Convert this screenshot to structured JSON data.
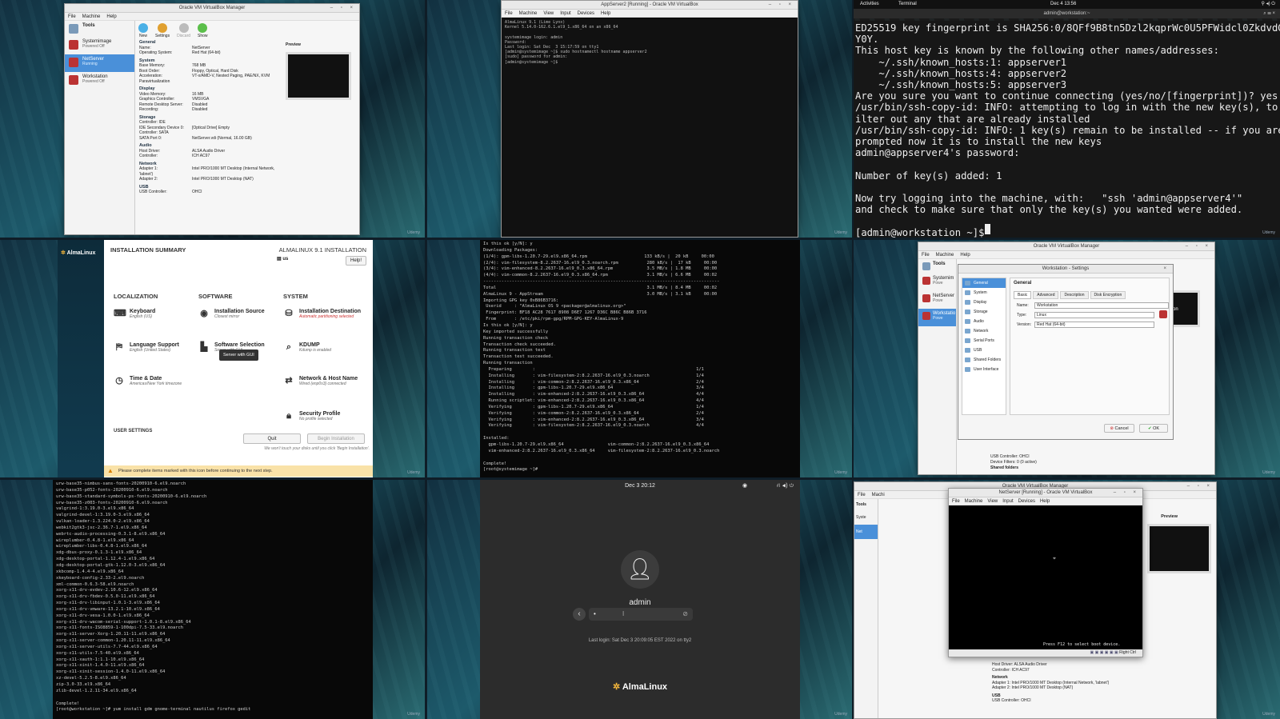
{
  "watermark": "Udemy",
  "p1": {
    "title": "Oracle VM VirtualBox Manager",
    "menu": [
      "File",
      "Machine",
      "Help"
    ],
    "tools_label": "Tools",
    "toolbar": [
      "New",
      "Settings",
      "Discard",
      "Show"
    ],
    "vms": [
      {
        "name": "Systemimage",
        "state": "Powered Off"
      },
      {
        "name": "NetServer",
        "state": "Running"
      },
      {
        "name": "Workstation",
        "state": "Powered Off"
      }
    ],
    "preview_label": "Preview",
    "sections": [
      {
        "title": "General",
        "rows": [
          [
            "Name:",
            "NetServer"
          ],
          [
            "Operating System:",
            "Red Hat (64-bit)"
          ]
        ]
      },
      {
        "title": "System",
        "rows": [
          [
            "Base Memory:",
            "768 MB"
          ],
          [
            "Boot Order:",
            "Floppy, Optical, Hard Disk"
          ],
          [
            "Acceleration:",
            "VT-x/AMD-V, Nested Paging, PAE/NX, KVM Paravirtualization"
          ]
        ]
      },
      {
        "title": "Display",
        "rows": [
          [
            "Video Memory:",
            "16 MB"
          ],
          [
            "Graphics Controller:",
            "VMSVGA"
          ],
          [
            "Remote Desktop Server:",
            "Disabled"
          ],
          [
            "Recording:",
            "Disabled"
          ]
        ]
      },
      {
        "title": "Storage",
        "rows": [
          [
            "Controller: IDE",
            ""
          ],
          [
            "IDE Secondary Device 0:",
            "[Optical Drive] Empty"
          ],
          [
            "Controller: SATA",
            ""
          ],
          [
            "SATA Port 0:",
            "NetServer.vdi (Normal, 16.00 GB)"
          ]
        ]
      },
      {
        "title": "Audio",
        "rows": [
          [
            "Host Driver:",
            "ALSA Audio Driver"
          ],
          [
            "Controller:",
            "ICH AC97"
          ]
        ]
      },
      {
        "title": "Network",
        "rows": [
          [
            "Adapter 1:",
            "Intel PRO/1000 MT Desktop (Internal Network, 'labnet')"
          ],
          [
            "Adapter 2:",
            "Intel PRO/1000 MT Desktop (NAT)"
          ]
        ]
      },
      {
        "title": "USB",
        "rows": [
          [
            "USB Controller:",
            "OHCI"
          ]
        ]
      }
    ]
  },
  "p2": {
    "title": "AppServer2 [Running] - Oracle VM VirtualBox",
    "menu": [
      "File",
      "Machine",
      "View",
      "Input",
      "Devices",
      "Help"
    ],
    "console": "AlmaLinux 9.1 (Lime Lynx)\nKernel 5.14.0-162.6.1.el9_1.x86_64 on an x86_64\n\nsystemimage login: admin\nPassword:\nLast login: Sat Dec  3 15:17:59 on tty1\n[admin@systemimage ~]$ sudo hostnamectl hostname appserver2\n[sudo] password for admin:\n[admin@systemimage ~]$ "
  },
  "p3": {
    "activities": "Activities",
    "app": "Terminal",
    "clock": "Dec 4  13:56",
    "title": "admin@workstation:~",
    "console": "ED25519 key fingerprint is SHA256:0/8QFf9B8tn5Dzl2kqprWc0U5PFWidcl0ZkdvdGJ\nY0Y.\nThis host key is known by the following other names/addresses:\n    ~/.ssh/known_hosts:1: appserver1\n    ~/.ssh/known_hosts:4: appserver2\n    ~/.ssh/known_hosts:5: appserver3\nAre you sure you want to continue connecting (yes/no/[fingerprint])? yes\n/usr/bin/ssh-copy-id: INFO: attempting to log in with the new key(s), to f\nilter out any that are already installed\n/usr/bin/ssh-copy-id: INFO: 1 key(s) remain to be installed -- if you are\nprompted now it is to install the new keys\nadmin@appserver4's password:\n\nNumber of key(s) added: 1\n\nNow try logging into the machine, with:   \"ssh 'admin@appserver4'\"\nand check to make sure that only the key(s) you wanted were added.\n\n[admin@workstation ~]$ "
  },
  "p4": {
    "logo": "AlmaLinux",
    "heading": "INSTALLATION SUMMARY",
    "product": "ALMALINUX 9.1 INSTALLATION",
    "keyboard": "us",
    "help": "Help!",
    "col_localization": "LOCALIZATION",
    "col_software": "SOFTWARE",
    "col_system": "SYSTEM",
    "spokes": {
      "keyboard": {
        "name": "Keyboard",
        "status": "English (US)"
      },
      "language": {
        "name": "Language Support",
        "status": "English (United States)"
      },
      "time": {
        "name": "Time & Date",
        "status": "Americas/New York timezone"
      },
      "source": {
        "name": "Installation Source",
        "status": "Closest mirror"
      },
      "selection": {
        "name": "Software Selection",
        "status": "Server with GUI"
      },
      "destination": {
        "name": "Installation Destination",
        "status": "Automatic partitioning selected"
      },
      "kdump": {
        "name": "KDUMP",
        "status": "Kdump is enabled"
      },
      "network": {
        "name": "Network & Host Name",
        "status": "Wired (enp0s3) connected"
      },
      "security": {
        "name": "Security Profile",
        "status": "No profile selected"
      }
    },
    "tooltip": "Server with GUI",
    "user_settings": "USER SETTINGS",
    "quit": "Quit",
    "begin": "Begin Installation",
    "note": "We won't touch your disks until you click 'Begin Installation'.",
    "warning": "Please complete items marked with this icon before continuing to the next step."
  },
  "p5": {
    "console": "Is this ok [y/N]: y\nDownloading Packages:\n(1/4): gpm-libs-1.20.7-29.el9.x86_64.rpm                      133 kB/s |  20 kB     00:00\n(2/4): vim-filesystem-8.2.2637-16.el9_0.3.noarch.rpm           280 kB/s |  17 kB     00:00\n(3/4): vim-enhanced-8.2.2637-16.el9_0.3.x86_64.rpm             3.5 MB/s | 1.8 MB     00:00\n(4/4): vim-common-8.2.2637-16.el9_0.3.x86_64.rpm               3.1 MB/s | 6.6 MB     00:02\n-------------------------------------------------------------------------------------------\nTotal                                                          3.1 MB/s | 8.4 MB     00:02\nAlmaLinux 9 - AppStream                                        3.0 MB/s | 3.1 kB     00:00\nImporting GPG key 0xB86B3716:\n Userid     : \"AlmaLinux OS 9 <packager@almalinux.org>\"\n Fingerprint: BF18 AC28 7617 8908 D6E7 1267 D36C B86C B86B 3716\n From       : /etc/pki/rpm-gpg/RPM-GPG-KEY-AlmaLinux-9\nIs this ok [y/N]: y\nKey imported successfully\nRunning transaction check\nTransaction check succeeded.\nRunning transaction test\nTransaction test succeeded.\nRunning transaction\n  Preparing        :                                                              1/1\n  Installing       : vim-filesystem-2:8.2.2637-16.el9_0.3.noarch                  1/4\n  Installing       : vim-common-2:8.2.2637-16.el9_0.3.x86_64                      2/4\n  Installing       : gpm-libs-1.20.7-29.el9.x86_64                                3/4\n  Installing       : vim-enhanced-2:8.2.2637-16.el9_0.3.x86_64                    4/4\n  Running scriptlet: vim-enhanced-2:8.2.2637-16.el9_0.3.x86_64                    4/4\n  Verifying        : gpm-libs-1.20.7-29.el9.x86_64                                1/4\n  Verifying        : vim-common-2:8.2.2637-16.el9_0.3.x86_64                      2/4\n  Verifying        : vim-enhanced-2:8.2.2637-16.el9_0.3.x86_64                    3/4\n  Verifying        : vim-filesystem-2:8.2.2637-16.el9_0.3.noarch                  4/4\n\nInstalled:\n  gpm-libs-1.20.7-29.el9.x86_64                 vim-common-2:8.2.2637-16.el9_0.3.x86_64\n  vim-enhanced-2:8.2.2637-16.el9_0.3.x86_64     vim-filesystem-2:8.2.2637-16.el9_0.3.noarch\n\nComplete!\n[root@systemimage ~]# "
  },
  "p6": {
    "title": "Oracle VM VirtualBox Manager",
    "menu": [
      "File",
      "Machine",
      "Help"
    ],
    "tools_label": "Tools",
    "vms": [
      "Systemim",
      "NetServer",
      "Workstatio"
    ],
    "vm_states": [
      "Powe",
      "Powe",
      "Powe"
    ],
    "dialog_title": "Workstation - Settings",
    "categories": [
      "General",
      "System",
      "Display",
      "Storage",
      "Audio",
      "Network",
      "Serial Ports",
      "USB",
      "Shared Folders",
      "User Interface"
    ],
    "section": "General",
    "tabs": [
      "Basic",
      "Advanced",
      "Description",
      "Disk Encryption"
    ],
    "name_label": "Name:",
    "name_value": "Workstation",
    "type_label": "Type:",
    "type_value": "Linux",
    "version_label": "Version:",
    "version_value": "Red Hat (64-bit)",
    "cancel": "Cancel",
    "ok": "OK",
    "preview_caption": "station",
    "bottom_lines": [
      "USB Controller:   OHCI",
      "Device Filters:   0 (0 active)"
    ],
    "shared_folders": "Shared folders"
  },
  "p7": {
    "console": "urw-base35-nimbus-sans-fonts-20200910-6.el9.noarch\nurw-base35-p052-fonts-20200910-6.el9.noarch\nurw-base35-standard-symbols-ps-fonts-20200910-6.el9.noarch\nurw-base35-z003-fonts-20200910-6.el9.noarch\nvalgrind-1:3.19.0-3.el9.x86_64\nvalgrind-devel-1:3.19.0-3.el9.x86_64\nvulkan-loader-1.3.224.0-2.el9.x86_64\nwebkit2gtk3-jsc-2.36.7-1.el9.x86_64\nwebrtc-audio-processing-0.3.1-8.el9.x86_64\nwireplumber-0.4.8-1.el9.x86_64\nwireplumber-libs-0.4.8-1.el9.x86_64\nxdg-dbus-proxy-0.1.3-1.el9.x86_64\nxdg-desktop-portal-1.12.4-1.el9.x86_64\nxdg-desktop-portal-gtk-1.12.0-3.el9.x86_64\nxkbcomp-1.4.4-4.el9.x86_64\nxkeyboard-config-2.33-2.el9.noarch\nxml-common-0.6.3-58.el9.noarch\nxorg-x11-drv-evdev-2.10.6-12.el9.x86_64\nxorg-x11-drv-fbdev-0.5.0-11.el9.x86_64\nxorg-x11-drv-libinput-1.0.1-3.el9.x86_64\nxorg-x11-drv-vmware-13.2.1-10.el9.x86_64\nxorg-x11-drv-vesa-1.0.0-1.el9.x86_64\nxorg-x11-drv-wacom-serial-support-1.0.1-8.el9.x86_64\nxorg-x11-fonts-ISO8859-1-100dpi-7.5-33.el9.noarch\nxorg-x11-server-Xorg-1.20.11-11.el9.x86_64\nxorg-x11-server-common-1.20.11-11.el9.x86_64\nxorg-x11-server-utils-7.7-44.el9.x86_64\nxorg-x11-utils-7.5-40.el9.x86_64\nxorg-x11-xauth-1:1.1-10.el9.x86_64\nxorg-x11-xinit-1.4.0-11.el9.x86_64\nxorg-x11-xinit-session-1.4.0-11.el9.x86_64\nxz-devel-5.2.5-8.el9.x86_64\nzip-3.0-33.el9.x86_64\nzlib-devel-1.2.11-34.el9.x86_64\n\nComplete!\n[root@workstation ~]# yum install gdm gnome-terminal nautilus firefox gedit"
  },
  "p8": {
    "clock": "Dec 3  20:12",
    "user": "admin",
    "password_mask": "•",
    "last_login": "Last login: Sat Dec  3 20:09:05 EST 2022 on tty2",
    "logo": "AlmaLinux"
  },
  "p9": {
    "bg_title": "Oracle VM VirtualBox Manager",
    "bg_menu": [
      "File",
      "Machi"
    ],
    "tools_label": "Tools",
    "vms": [
      "Syste",
      "Net"
    ],
    "preview_label": "Preview",
    "vm_title": "NetServer [Running] - Oracle VM VirtualBox",
    "vm_menu": [
      "File",
      "Machine",
      "View",
      "Input",
      "Devices",
      "Help"
    ],
    "boot_msg": "Press F12 to select boot device.",
    "right_ctrl": "Right Ctrl",
    "audio_rows": [
      "Host Driver:   ALSA Audio Driver",
      "Controller:    ICH AC97"
    ],
    "network_title": "Network",
    "net_rows": [
      "Adapter 1:  Intel PRO/1000 MT Desktop (Internal Network, 'labnet')",
      "Adapter 2:  Intel PRO/1000 MT Desktop (NAT)"
    ],
    "usb_title": "USB",
    "usb_row": "USB Controller:  OHCI"
  }
}
